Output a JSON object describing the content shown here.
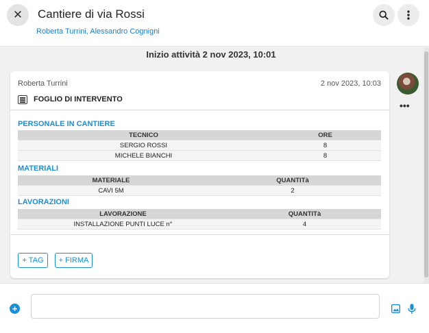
{
  "header": {
    "title": "Cantiere di via Rossi",
    "subtitle": "Roberta Turrini, Alessandro Cognigni",
    "close_icon": "close-icon",
    "search_icon": "search-icon",
    "menu_icon": "more-vertical-icon"
  },
  "activity": {
    "start_label": "Inizio attività 2 nov 2023, 10:01"
  },
  "message": {
    "author": "Roberta Turrini",
    "date": "2 nov 2023, 10:03",
    "form_title": "FOGLIO DI INTERVENTO",
    "personale": {
      "title": "PERSONALE IN CANTIERE",
      "headers": [
        "TECNICO",
        "ORE"
      ],
      "rows": [
        [
          "SERGIO ROSSI",
          "8"
        ],
        [
          "MICHELE BIANCHI",
          "8"
        ]
      ]
    },
    "materiali": {
      "title": "MATERIALI",
      "headers": [
        "MATERIALE",
        "QUANTITà"
      ],
      "rows": [
        [
          "CAVI 5M",
          "2"
        ]
      ]
    },
    "lavorazioni": {
      "title": "LAVORAZIONI",
      "headers": [
        "LAVORAZIONE",
        "QUANTITà"
      ],
      "rows": [
        [
          "INSTALLAZIONE PUNTI LUCE n°",
          "4"
        ]
      ]
    },
    "buttons": {
      "tag": "+ TAG",
      "firma": "+ FIRMA"
    },
    "more": "•••"
  },
  "composer": {
    "input_value": "",
    "placeholder": "",
    "plus": "+",
    "image_icon": "image-icon",
    "mic_icon": "microphone-icon"
  },
  "colors": {
    "accent": "#1a8fd6",
    "background": "#f1f1f1",
    "table_header": "#d6d6d6"
  }
}
